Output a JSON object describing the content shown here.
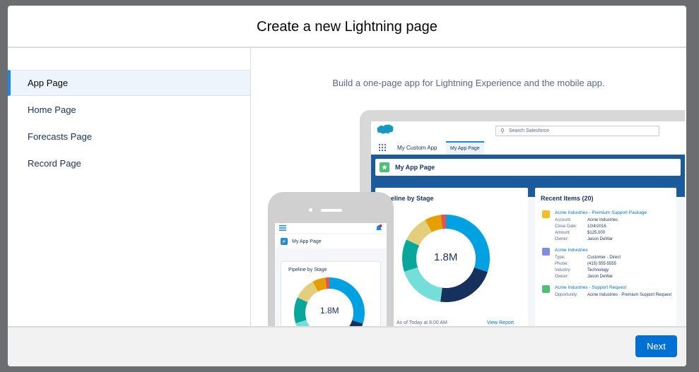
{
  "modal": {
    "title": "Create a new Lightning page",
    "sidebar": {
      "items": [
        {
          "label": "App Page",
          "active": true
        },
        {
          "label": "Home Page",
          "active": false
        },
        {
          "label": "Forecasts Page",
          "active": false
        },
        {
          "label": "Record Page",
          "active": false
        }
      ]
    },
    "description": "Build a one-page app for Lightning Experience and the mobile app.",
    "footer": {
      "next_label": "Next"
    }
  },
  "illustration": {
    "desktop": {
      "search_placeholder": "Search Salesforce",
      "tab_custom_app": "My Custom App",
      "tab_active": "My App Page",
      "page_title": "My App Page",
      "chart_card": {
        "title": "Pipeline by Stage",
        "center_value": "1.8M",
        "footer_text": "As of Today at 8:00 AM",
        "link": "View Report"
      },
      "recent_items": {
        "title": "Recent Items (20)",
        "items": [
          {
            "icon_color": "#f4bc25",
            "title": "Acme Industries - Premium Support Package",
            "fields": [
              {
                "key": "Account:",
                "value": "Acme Industries"
              },
              {
                "key": "Close Date:",
                "value": "10/4/2016"
              },
              {
                "key": "Amount:",
                "value": "$125,000"
              },
              {
                "key": "Owner:",
                "value": "Jason DeWar"
              }
            ]
          },
          {
            "icon_color": "#7f8de1",
            "title": "Acme Industries",
            "fields": [
              {
                "key": "Type:",
                "value": "Customer - Direct"
              },
              {
                "key": "Phone:",
                "value": "(415) 555-5555"
              },
              {
                "key": "Industry:",
                "value": "Technology"
              },
              {
                "key": "Owner:",
                "value": "Jason DeWar"
              }
            ]
          },
          {
            "icon_color": "#4bc076",
            "title": "Acme Industries - Support Request",
            "fields": [
              {
                "key": "Opportunity:",
                "value": "Acme Industries - Premium Support Request"
              }
            ]
          }
        ]
      }
    },
    "phone": {
      "page_title": "My App Page",
      "chart_title": "Pipeline by Stage",
      "center_value": "1.8M"
    },
    "donut_segments": [
      {
        "value": 30,
        "color": "#00a1e0"
      },
      {
        "value": 22,
        "color": "#16325c"
      },
      {
        "value": 18,
        "color": "#76ded9"
      },
      {
        "value": 12,
        "color": "#08a69b"
      },
      {
        "value": 10,
        "color": "#e2ce7d"
      },
      {
        "value": 6,
        "color": "#e69f00"
      },
      {
        "value": 2,
        "color": "#e3554c"
      }
    ]
  },
  "colors": {
    "accent": "#0070d2",
    "active_indicator": "#1589ee",
    "overlay": "#6b6d70"
  }
}
